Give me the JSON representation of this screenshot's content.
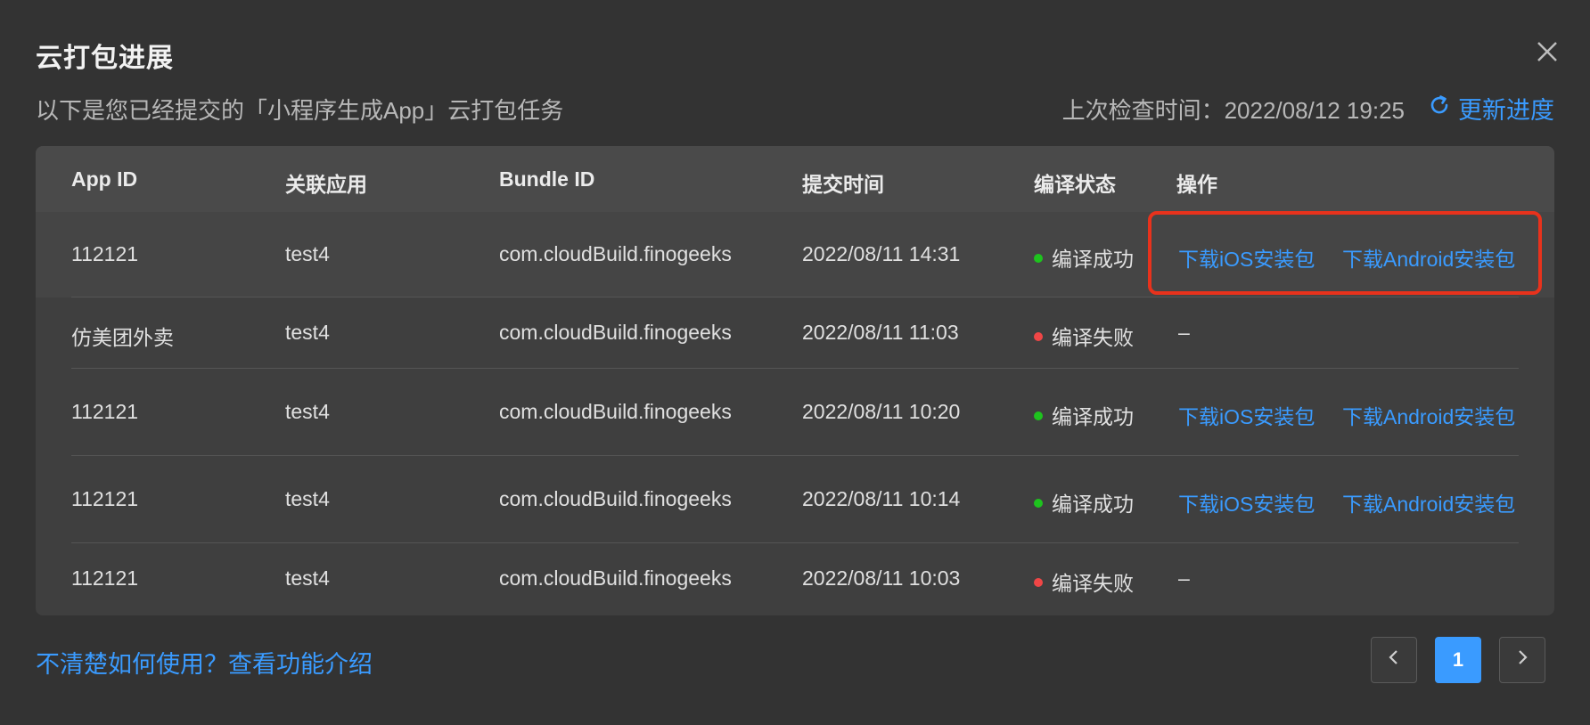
{
  "dialog": {
    "title": "云打包进展",
    "subtitle": "以下是您已经提交的「小程序生成App」云打包任务",
    "last_check_label": "上次检查时间：2022/08/12 19:25",
    "refresh_label": "更新进度",
    "close_icon": "close-icon",
    "refresh_icon": "refresh-icon"
  },
  "table": {
    "headers": [
      "App ID",
      "关联应用",
      "Bundle ID",
      "提交时间",
      "编译状态",
      "操作"
    ],
    "rows": [
      {
        "app_id": "112121",
        "linked_app": "test4",
        "bundle_id": "com.cloudBuild.finogeeks",
        "submit_time": "2022/08/11 14:31",
        "status": "编译成功",
        "status_color": "#1ec31e",
        "ios_link": "下载iOS安装包",
        "android_link": "下载Android安装包",
        "action_placeholder": ""
      },
      {
        "app_id": "仿美团外卖",
        "linked_app": "test4",
        "bundle_id": "com.cloudBuild.finogeeks",
        "submit_time": "2022/08/11 11:03",
        "status": "编译失败",
        "status_color": "#f04646",
        "ios_link": "",
        "android_link": "",
        "action_placeholder": "–"
      },
      {
        "app_id": "112121",
        "linked_app": "test4",
        "bundle_id": "com.cloudBuild.finogeeks",
        "submit_time": "2022/08/11 10:20",
        "status": "编译成功",
        "status_color": "#1ec31e",
        "ios_link": "下载iOS安装包",
        "android_link": "下载Android安装包",
        "action_placeholder": ""
      },
      {
        "app_id": "112121",
        "linked_app": "test4",
        "bundle_id": "com.cloudBuild.finogeeks",
        "submit_time": "2022/08/11 10:14",
        "status": "编译成功",
        "status_color": "#1ec31e",
        "ios_link": "下载iOS安装包",
        "android_link": "下载Android安装包",
        "action_placeholder": ""
      },
      {
        "app_id": "112121",
        "linked_app": "test4",
        "bundle_id": "com.cloudBuild.finogeeks",
        "submit_time": "2022/08/11 10:03",
        "status": "编译失败",
        "status_color": "#f04646",
        "ios_link": "",
        "android_link": "",
        "action_placeholder": "–"
      }
    ]
  },
  "footer": {
    "help_link": "不清楚如何使用？查看功能介绍",
    "pagination": {
      "prev_icon": "chevron-left-icon",
      "current_page": "1",
      "next_icon": "chevron-right-icon"
    }
  },
  "colors": {
    "accent": "#3a9bff",
    "success": "#1ec31e",
    "error": "#f04646",
    "highlight_border": "#e8321c"
  }
}
